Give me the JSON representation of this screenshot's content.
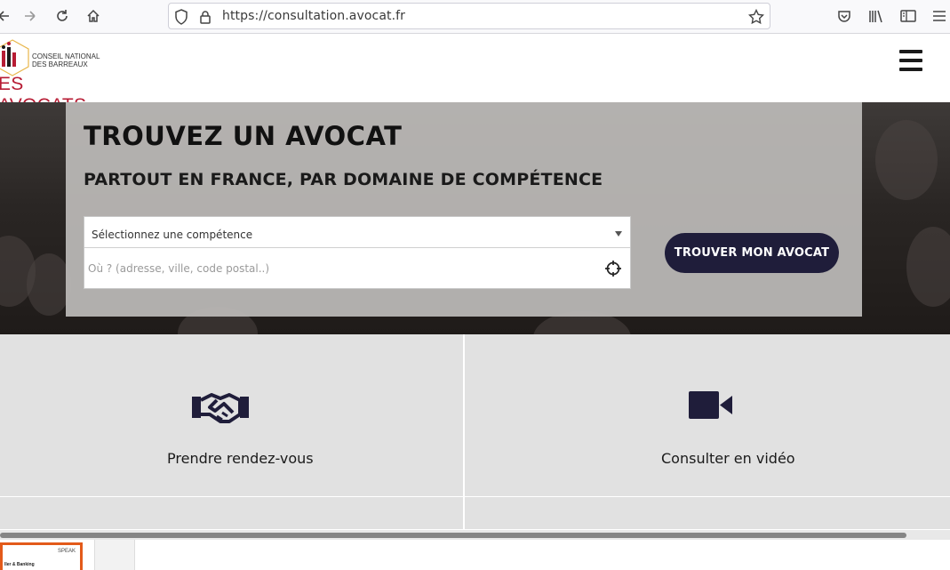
{
  "browser": {
    "url": "https://consultation.avocat.fr",
    "icons": [
      "back-icon",
      "forward-icon",
      "reload-icon",
      "home-icon",
      "shield-icon",
      "lock-icon",
      "bookmark-star-icon",
      "pocket-icon",
      "library-icon",
      "sidebar-icon",
      "menu-icon"
    ]
  },
  "header": {
    "logo_line1": "CONSEIL NATIONAL",
    "logo_line2": "DES BARREAUX",
    "logo_main": "ES AVOCATS",
    "menu_icon": "hamburger-menu-icon"
  },
  "hero": {
    "title": "TROUVEZ UN AVOCAT",
    "subtitle": "PARTOUT EN FRANCE, PAR DOMAINE DE COMPÉTENCE",
    "select_value": "Sélectionnez une compétence",
    "location_placeholder": "Où ? (adresse, ville, code postal..)",
    "button_label": "TROUVER MON AVOCAT"
  },
  "services": [
    {
      "label": "Prendre rendez-vous",
      "icon": "handshake-icon"
    },
    {
      "label": "Consulter en vidéo",
      "icon": "video-camera-icon"
    }
  ],
  "taskbar": {
    "thumb_text1": "SPEAK",
    "thumb_text2": "ller & Banking"
  },
  "colors": {
    "brand_red": "#b71c34",
    "button_navy": "#1f1d3a",
    "tile_bg": "#e1e1e1"
  }
}
